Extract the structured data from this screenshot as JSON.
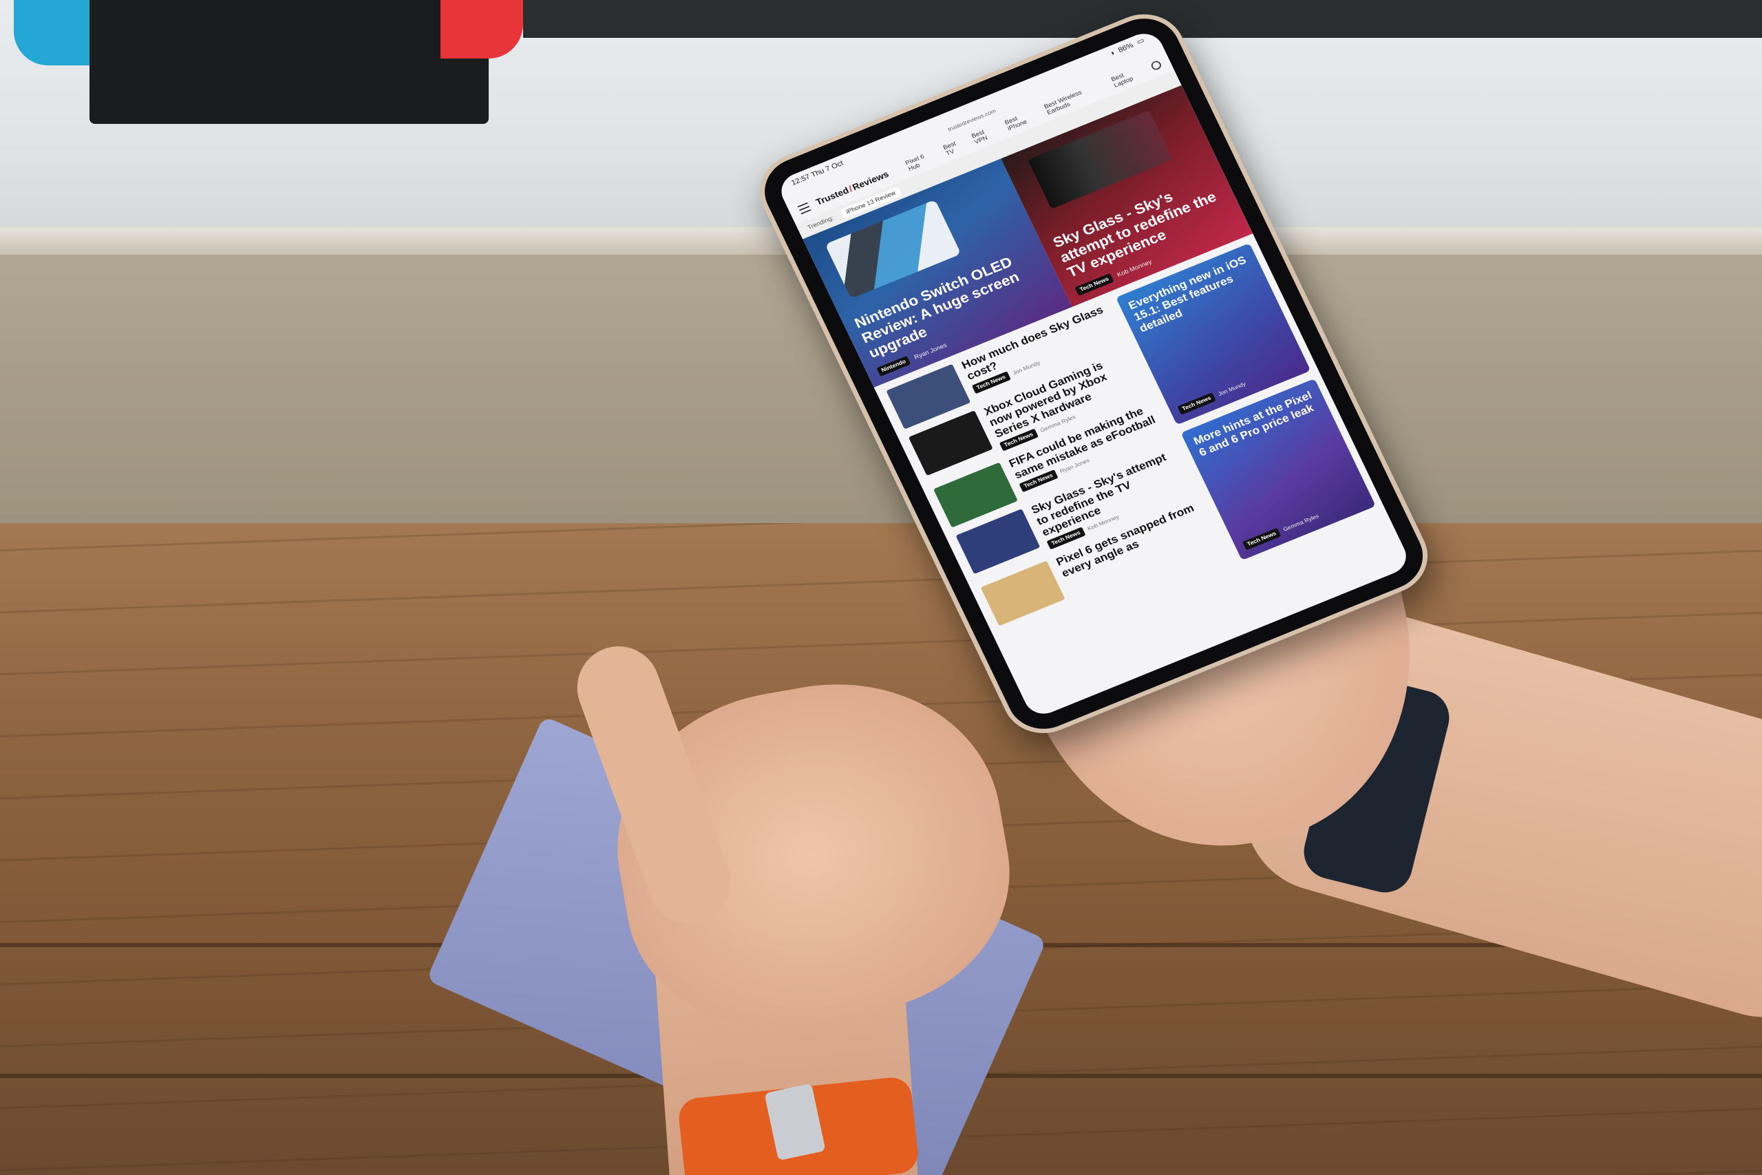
{
  "device": {
    "status_time": "12:57",
    "status_date": "Thu 7 Oct",
    "battery": "86%",
    "url": "trustedreviews.com"
  },
  "site": {
    "logo_left": "Trusted",
    "logo_right": "Reviews",
    "nav_links": [
      "Pixel 6 Hub",
      "Best TV",
      "Best VPN",
      "Best iPhone",
      "Best Wireless Earbuds",
      "Best Laptop"
    ],
    "trending_label": "Trending:",
    "trending_items": [
      "iPhone 13 Review"
    ]
  },
  "hero": {
    "left": {
      "title": "Nintendo Switch OLED Review: A huge screen upgrade",
      "tag": "Nintendo",
      "author": "Ryan Jones"
    },
    "right": {
      "title": "Sky Glass - Sky's attempt to redefine the TV experience",
      "tag": "Tech News",
      "author": "Kob Monney"
    }
  },
  "articles": [
    {
      "title": "How much does Sky Glass cost?",
      "tag": "Tech News",
      "author": "Jon Mundy",
      "thumb_color": "#3b4f7a"
    },
    {
      "title": "Xbox Cloud Gaming is now powered by Xbox Series X hardware",
      "tag": "Tech News",
      "author": "Gemma Ryles",
      "thumb_color": "#1a1a1a"
    },
    {
      "title": "FIFA could be making the same mistake as eFootball",
      "tag": "Tech News",
      "author": "Ryan Jones",
      "thumb_color": "#2f6b3a"
    },
    {
      "title": "Sky Glass - Sky's attempt to redefine the TV experience",
      "tag": "Tech News",
      "author": "Kob Monney",
      "thumb_color": "#2e3e7a"
    },
    {
      "title": "Pixel 6 gets snapped from every angle as",
      "tag": "",
      "author": "",
      "thumb_color": "#d9b478"
    }
  ],
  "sidebar": [
    {
      "title": "Everything new in iOS 15.1: Best features detailed",
      "tag": "Tech News",
      "author": "Jon Mundy",
      "color": "#3d49a8"
    },
    {
      "title": "More hints at the Pixel 6 and 6 Pro price leak",
      "tag": "Tech News",
      "author": "Gemma Ryles",
      "color": "#5a3aa0"
    }
  ]
}
